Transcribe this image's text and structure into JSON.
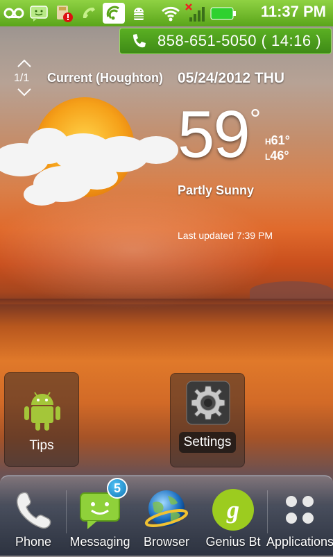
{
  "statusbar": {
    "time": "11:37 PM",
    "icons": [
      "voicemail-icon",
      "messaging-icon",
      "sd-card-error-icon",
      "phone-call-icon",
      "sync-icon",
      "android-debug-icon",
      "wifi-icon",
      "signal-no-service-icon",
      "battery-icon"
    ]
  },
  "call": {
    "text": "858-651-5050  ( 14:16 )"
  },
  "weather": {
    "page": "1/1",
    "location": "Current (Houghton)",
    "date": "05/24/2012 THU",
    "temp": "59",
    "degree": "°",
    "high_prefix": "H",
    "high": "61°",
    "low_prefix": "L",
    "low": "46°",
    "condition": "Partly Sunny",
    "updated": "Last updated 7:39 PM"
  },
  "shortcuts": {
    "tips": "Tips",
    "settings": "Settings"
  },
  "dock": {
    "phone": "Phone",
    "messaging": "Messaging",
    "messaging_badge": "5",
    "browser": "Browser",
    "genius": "Genius Bt",
    "applications": "Applications"
  },
  "colors": {
    "statusbar": "#6ab52a",
    "android_green": "#a4c639",
    "badge_blue": "#1e90d6",
    "genius_green": "#9ccc1f"
  }
}
